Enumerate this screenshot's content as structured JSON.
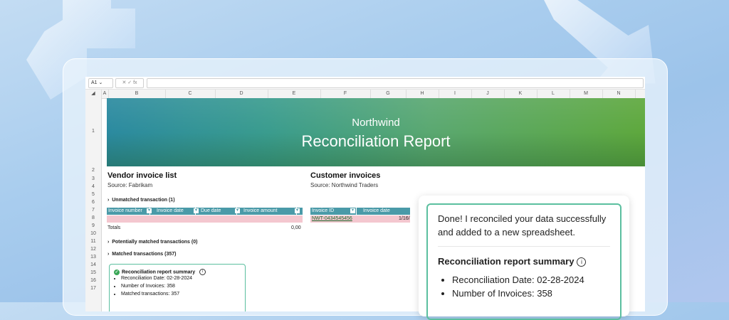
{
  "formula_bar": {
    "cell_ref": "A1",
    "fx_icons": "✕ ✓ fx"
  },
  "columns": [
    "A",
    "B",
    "C",
    "D",
    "E",
    "F",
    "G",
    "H",
    "I",
    "J",
    "K",
    "L",
    "M",
    "N"
  ],
  "rows": [
    "1",
    "2",
    "3",
    "4",
    "5",
    "6",
    "7",
    "8",
    "9",
    "10",
    "11",
    "12",
    "13",
    "14",
    "15",
    "16",
    "17"
  ],
  "banner": {
    "subtitle": "Northwind",
    "title": "Reconciliation Report"
  },
  "vendor": {
    "title": "Vendor invoice list",
    "source": "Source: Fabrikam",
    "group_unmatched": "Unmatched transaction (1)",
    "headers": [
      "Invoice number",
      "Invoice date",
      "Due date",
      "Invoice amount"
    ],
    "totals_label": "Totals",
    "totals_value": "0,00",
    "group_potential": "Potentially matched transactions (0)",
    "group_matched": "Matched transactions (357)"
  },
  "customer": {
    "title": "Customer invoices",
    "source": "Source: Northwind Traders",
    "headers": [
      "Invoice ID",
      "Invoice date"
    ],
    "row_id": "NWT-0434545456",
    "row_date": "1/16/"
  },
  "mini_summary": {
    "title": "Reconciliation report summary",
    "items": [
      "Reconciliation Date: 02-28-2024",
      "Number of Invoices: 358",
      "Matched transactions: 357"
    ]
  },
  "chat": {
    "message": "Done! I reconciled your data successfully and added to a new spreadsheet.",
    "summary_title": "Reconciliation report summary",
    "items": [
      "Reconciliation Date: 02-28-2024",
      "Number of Invoices: 358"
    ]
  },
  "colors": {
    "accent": "#4a9aa8",
    "card_border": "#5bbf9f",
    "pink_row": "#f4c7cf"
  }
}
